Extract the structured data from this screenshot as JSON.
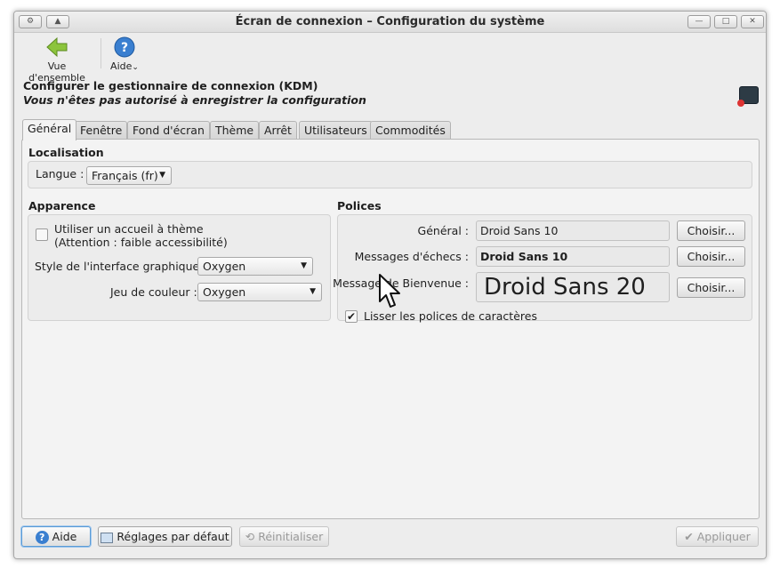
{
  "window": {
    "title": "Écran de connexion – Configuration du système",
    "buttons": {
      "menu": "⚙",
      "shade": "▲",
      "minimize": "—",
      "maximize": "□",
      "close": "✕"
    }
  },
  "toolbar": {
    "overview_label": "Vue d'ensemble",
    "help_label": "Aide",
    "help_menu_indicator": "⌄"
  },
  "header": {
    "title": "Configurer le gestionnaire de connexion (KDM)",
    "notice": "Vous n'êtes pas autorisé à enregistrer la configuration"
  },
  "tabs": [
    "Général",
    "Fenêtre",
    "Fond d'écran",
    "Thème",
    "Arrêt",
    "Utilisateurs",
    "Commodités"
  ],
  "active_tab": "Général",
  "localisation": {
    "title": "Localisation",
    "language_label": "Langue :",
    "language_value": "Français (fr)"
  },
  "appearance": {
    "title": "Apparence",
    "themed_greeter_label": "Utiliser un accueil à thème",
    "themed_greeter_note": "(Attention : faible accessibilité)",
    "themed_greeter_checked": false,
    "gui_style_label": "Style de l'interface graphique :",
    "gui_style_value": "Oxygen",
    "color_scheme_label": "Jeu de couleur :",
    "color_scheme_value": "Oxygen"
  },
  "fonts": {
    "title": "Polices",
    "general_label": "Général :",
    "general_value": "Droid Sans 10",
    "failure_label": "Messages d'échecs :",
    "failure_value": "Droid Sans 10",
    "welcome_label": "Message de Bienvenue :",
    "welcome_value": "Droid Sans 20",
    "choose_label": "Choisir...",
    "antialias_label": "Lisser les polices de caractères",
    "antialias_checked": true
  },
  "footer": {
    "help_label": "Aide",
    "defaults_label": "Réglages par défaut",
    "reset_label": "Réinitialiser",
    "apply_label": "Appliquer"
  },
  "colors": {
    "accent": "#5b9bd6",
    "back_arrow": "#8cc43c"
  }
}
